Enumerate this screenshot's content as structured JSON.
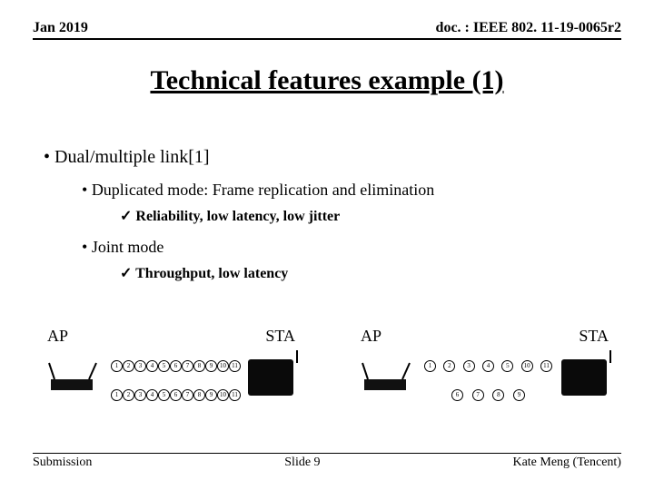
{
  "header": {
    "date": "Jan 2019",
    "doc": "doc. : IEEE 802. 11-19-0065r2"
  },
  "title": "Technical features example (1)",
  "bullets": {
    "lvl1": "Dual/multiple link[1]",
    "lvl2a": "Duplicated mode: Frame replication and elimination",
    "lvl3a": "Reliability, low latency, low jitter",
    "lvl2b": "Joint mode",
    "lvl3b": "Throughput, low latency"
  },
  "labels": {
    "ap": "AP",
    "sta": "STA"
  },
  "diagram1": {
    "seq_top": [
      "1",
      "2",
      "3",
      "4",
      "5",
      "6",
      "7",
      "8",
      "9",
      "10",
      "11"
    ],
    "seq_bottom": [
      "1",
      "2",
      "3",
      "4",
      "5",
      "6",
      "7",
      "8",
      "9",
      "10",
      "11"
    ]
  },
  "diagram2": {
    "seq_top": [
      "1",
      "2",
      "3",
      "4",
      "5",
      "10",
      "11"
    ],
    "seq_bottom": [
      "6",
      "7",
      "8",
      "9"
    ]
  },
  "footer": {
    "left": "Submission",
    "center": "Slide 9",
    "right": "Kate Meng (Tencent)"
  }
}
